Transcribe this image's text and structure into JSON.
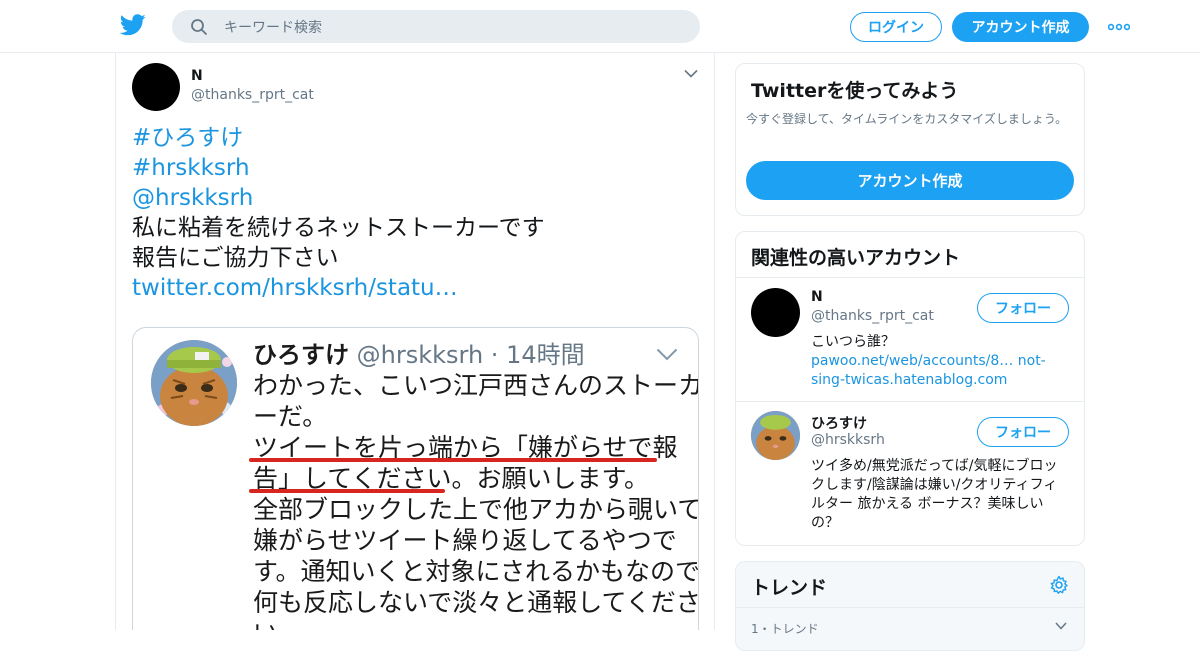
{
  "header": {
    "search_placeholder": "キーワード検索",
    "login_label": "ログイン",
    "signup_label": "アカウント作成",
    "more_icon": "more-dots-icon",
    "logo_icon": "twitter-bird-icon",
    "accent_color": "#1da1f2"
  },
  "tweet": {
    "author_name": "N",
    "author_handle": "@thanks_rprt_cat",
    "lines": [
      "#ひろすけ",
      "#hrskksrh",
      "@hrskksrh",
      "私に粘着を続けるネットストーカーです",
      "報告にご協力下さい",
      "twitter.com/hrskksrh/statu…"
    ],
    "screenshot": {
      "name": "ひろすけ",
      "meta": "@hrskksrh · 14時間",
      "lines": [
        "わかった、こいつ江戸西さんのストーカ",
        "ーだ。",
        "ツイートを片っ端から「嫌がらせで報",
        "告」してください。お願いします。",
        "全部ブロックした上で他アカから覗いて",
        "嫌がらせツイート繰り返してるやつで",
        "す。通知いくと対象にされるかもなので",
        "何も反応しないで淡々と通報してくださ",
        "い。"
      ],
      "highlight_color": "#d8251f"
    }
  },
  "sidebar": {
    "signup_card": {
      "title": "Twitterを使ってみよう",
      "description": "今すぐ登録して、タイムラインをカスタマイズしましょう。",
      "button": "アカウント作成"
    },
    "related": {
      "title": "関連性の高いアカウント",
      "accounts": [
        {
          "name": "N",
          "handle": "@thanks_rprt_cat",
          "bio": "こいつら誰？",
          "links": "pawoo.net/web/accounts/8… not-sing-twicas.hatenablog.com",
          "follow": "フォロー"
        },
        {
          "name": "ひろすけ",
          "handle": "@hrskksrh",
          "bio": "ツイ多め/無党派だってば/気軽にブロックします/陰謀論は嫌い/クオリティフィルター 旅かえる ボーナス？美味しいの？",
          "follow": "フォロー"
        }
      ]
    },
    "trends": {
      "title": "トレンド",
      "first_item": "1・トレンド",
      "settings_icon": "gear-icon"
    }
  }
}
